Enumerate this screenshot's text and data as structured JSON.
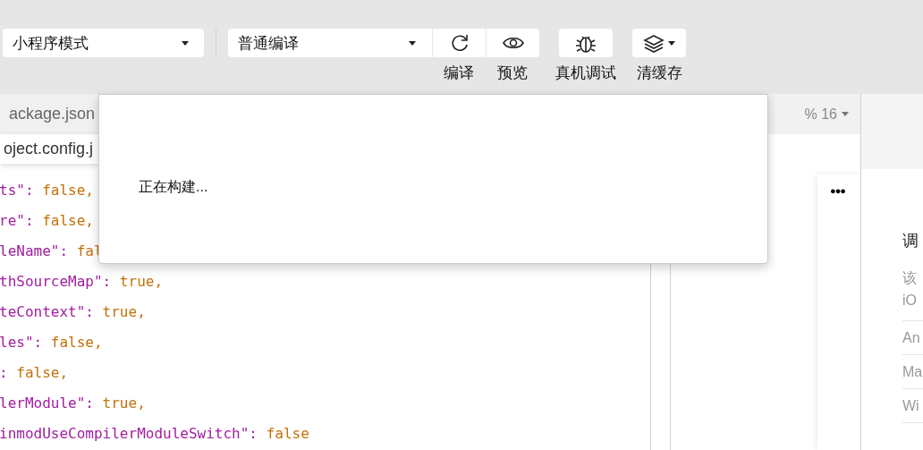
{
  "toolbar": {
    "mode_select": "小程序模式",
    "compile_select": "普通编译",
    "buttons": [
      {
        "label": "编译",
        "joined": true,
        "has_menu": false
      },
      {
        "label": "预览",
        "joined": true,
        "has_menu": false
      },
      {
        "label": "真机调试",
        "joined": false,
        "has_menu": false
      },
      {
        "label": "清缓存",
        "joined": false,
        "has_menu": true
      }
    ]
  },
  "editor": {
    "tabs": [
      {
        "label": "ackage.json"
      }
    ],
    "tab_menu": [
      "oject.config.j"
    ],
    "code_lines": [
      {
        "key": "ts\": ",
        "value": "false,"
      },
      {
        "key": "re\": ",
        "value": "false,"
      },
      {
        "key": "leName\": ",
        "value": "fal"
      },
      {
        "key": "thSourceMap\": ",
        "value": "true,"
      },
      {
        "key": "teContext\": ",
        "value": "true,"
      },
      {
        "key": "les\": ",
        "value": "false,"
      },
      {
        "key": ": ",
        "value": "false,"
      },
      {
        "key": "lerModule\": ",
        "value": "true,"
      },
      {
        "key": "inmodUseCompilerModuleSwitch\": ",
        "value": "false"
      }
    ]
  },
  "simulator": {
    "zoom": "% 16",
    "status": "●●●"
  },
  "details_panel": {
    "title": "调",
    "description": "该",
    "items": [
      "iO",
      "An",
      "Ma",
      "Wi"
    ]
  },
  "dialog": {
    "message": "正在构建..."
  }
}
